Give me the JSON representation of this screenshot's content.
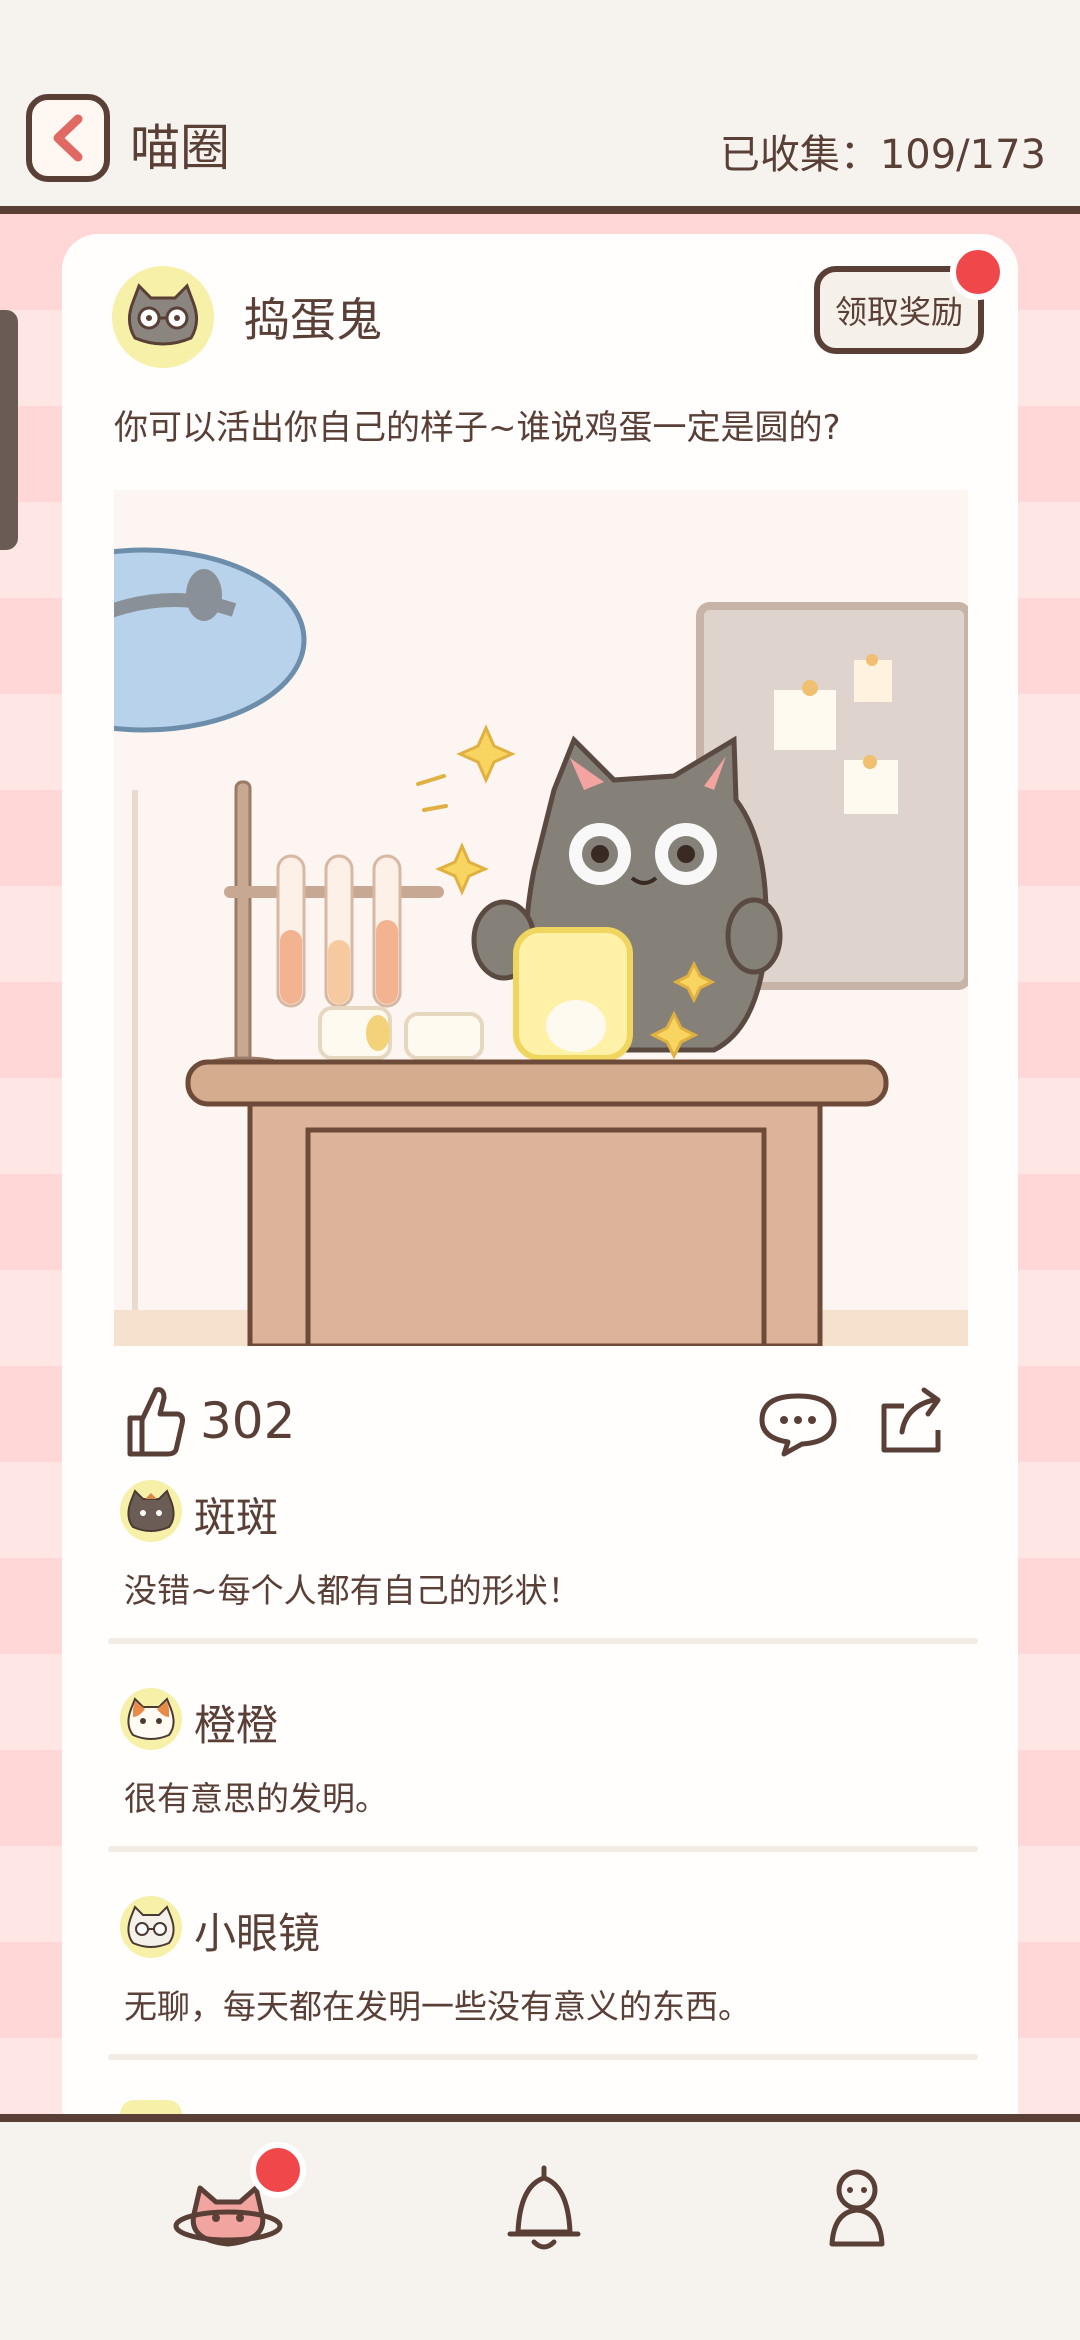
{
  "header": {
    "title": "喵圈",
    "collected_label": "已收集：",
    "collected_count": "109/173"
  },
  "post": {
    "author": "捣蛋鬼",
    "reward_button": "领取奖励",
    "text": "你可以活出你自己的样子~谁说鸡蛋一定是圆的?",
    "likes": "302"
  },
  "comments": [
    {
      "name": "斑斑",
      "text": "没错~每个人都有自己的形状！"
    },
    {
      "name": "橙橙",
      "text": "很有意思的发明。"
    },
    {
      "name": "小眼镜",
      "text": "无聊，每天都在发明一些没有意义的东西。"
    }
  ],
  "icons": {
    "back": "chevron-left-icon",
    "like": "thumbs-up-icon",
    "comment": "speech-bubble-icon",
    "share": "share-icon",
    "nav_home": "cat-planet-icon",
    "nav_notify": "bell-icon",
    "nav_profile": "person-icon"
  },
  "colors": {
    "accent": "#5a3f37",
    "badge": "#f0474b",
    "background_stripe_a": "#ffd7d6",
    "background_stripe_b": "#fde6e4"
  }
}
